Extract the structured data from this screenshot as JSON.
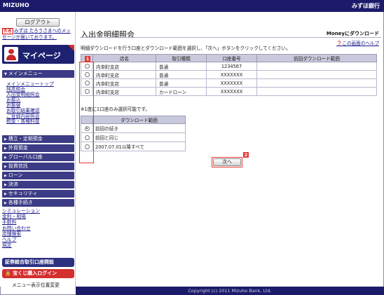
{
  "header": {
    "logo": "MIZUHO",
    "bank_name": "みずほ銀行"
  },
  "sidebar": {
    "logout_label": "ログアウト",
    "welcome": {
      "badge": "新着",
      "name_link": "みずほ たろうさま",
      "message": "へのメッセージが届いております。"
    },
    "mypage_label": "マイページ",
    "main_menu_label": "メインメニュー",
    "main_menu_links": [
      "メインメニュートップ",
      "残高照会",
      "入出金明細照会",
      "お振込",
      "お振替",
      "お取引結果確認",
      "ご登録内容照会",
      "税金・各種料金"
    ],
    "categories": [
      "積立・定期預金",
      "外貨預金",
      "グローバル口座",
      "投資信託",
      "ローン",
      "決済",
      "セキュリティ",
      "各種手続き"
    ],
    "sub_links": [
      "シミュレーション",
      "金利・相場",
      "手数料",
      "お問い合わせ",
      "店舗検索",
      "ヘルプ",
      "規定"
    ],
    "btn_securities": "証券総合取引口座開設",
    "btn_lottery": "宝くじ購入ログイン",
    "menu_position": "メニュー表示位置変更"
  },
  "main": {
    "title": "入出金明細照会",
    "money_link": "Moneyにダウンロード",
    "help_link": "この画面のヘルプ",
    "instruction": "明細ダウンロードを行う口座とダウンロード範囲を選択し、「次へ」ボタンをクリックしてください。",
    "account_table": {
      "headers": [
        "店名",
        "取引種類",
        "口座番号",
        "前回ダウンロード範囲"
      ],
      "rows": [
        {
          "branch": "内幸町支店",
          "type": "普通",
          "number": "1234567",
          "last": ""
        },
        {
          "branch": "内幸町支店",
          "type": "普通",
          "number": "XXXXXXX",
          "last": ""
        },
        {
          "branch": "内幸町支店",
          "type": "普通",
          "number": "XXXXXXX",
          "last": ""
        },
        {
          "branch": "内幸町支店",
          "type": "カードローン",
          "number": "XXXXXXX",
          "last": ""
        }
      ]
    },
    "note": "※1度に1口座のみ選択可能です。",
    "range_table": {
      "header": "ダウンロード範囲",
      "options": [
        "前回の続き",
        "前回と同じ",
        "2007.07.01以降すべて"
      ],
      "selected_index": 0
    },
    "marker1": "1",
    "marker2": "2",
    "next_label": "次へ"
  },
  "footer": {
    "copyright": "Copyright (c) 2011 Mizuho Bank, Ltd."
  },
  "colors": {
    "navy": "#1c1b6b",
    "accent_red": "#e53935",
    "table_header": "#c9c9dd"
  }
}
